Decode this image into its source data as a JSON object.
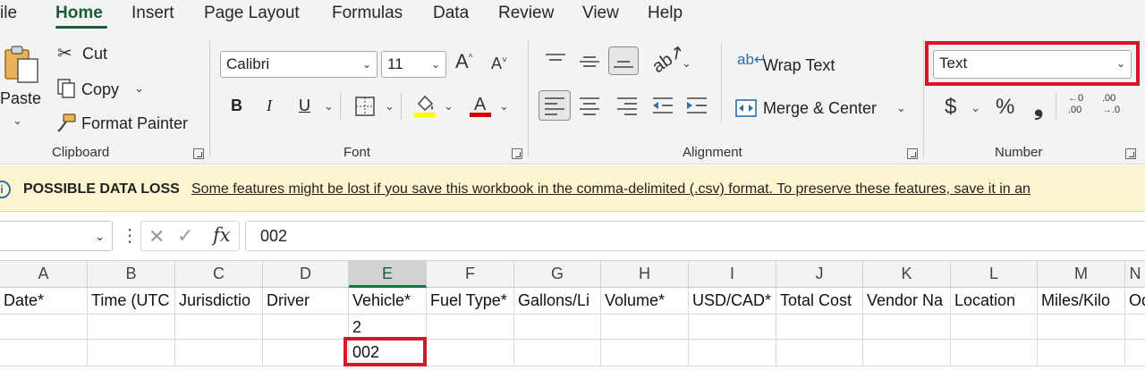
{
  "menu": {
    "items": [
      "ile",
      "Home",
      "Insert",
      "Page Layout",
      "Formulas",
      "Data",
      "Review",
      "View",
      "Help"
    ],
    "active": "Home"
  },
  "ribbon": {
    "clipboard": {
      "paste": "Paste",
      "cut": "Cut",
      "copy": "Copy",
      "format_painter": "Format Painter",
      "label": "Clipboard"
    },
    "font": {
      "font_name": "Calibri",
      "font_size": "11",
      "bold": "B",
      "italic": "I",
      "underline": "U",
      "label": "Font",
      "fill_color": "#ffff00",
      "font_color": "#d00000"
    },
    "alignment": {
      "wrap_text": "Wrap Text",
      "merge_center": "Merge & Center",
      "label": "Alignment"
    },
    "number": {
      "format": "Text",
      "currency": "$",
      "percent": "%",
      "comma": "❟",
      "label": "Number"
    }
  },
  "banner": {
    "title": "POSSIBLE DATA LOSS",
    "message": "Some features might be lost if you save this workbook in the comma-delimited (.csv) format. To preserve these features, save it in an"
  },
  "formula_bar": {
    "name_box": "",
    "fx": "fx",
    "value": "002"
  },
  "grid": {
    "columns": [
      "A",
      "B",
      "C",
      "D",
      "E",
      "F",
      "G",
      "H",
      "I",
      "J",
      "K",
      "L",
      "M",
      "N"
    ],
    "selected_column": "E",
    "header_row": [
      "Date*",
      "Time (UTC",
      "Jurisdictio",
      "Driver",
      "Vehicle*",
      "Fuel Type*",
      "Gallons/Li",
      "Volume*",
      "USD/CAD*",
      "Total Cost",
      "Vendor Na",
      "Location",
      "Miles/Kilo",
      "Od"
    ],
    "row2_e": "2",
    "row3_e": "002"
  },
  "highlight_color": "#d6142a",
  "accent_color": "#185c37"
}
